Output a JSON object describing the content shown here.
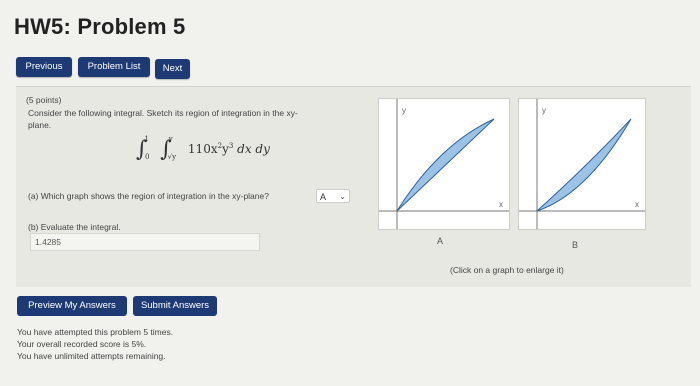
{
  "page": {
    "title": "HW5: Problem 5",
    "nav": {
      "previous": "Previous",
      "problem_list": "Problem List",
      "next": "Next"
    }
  },
  "problem": {
    "points": "(5 points)",
    "prompt_line1": "Consider the following integral. Sketch its region of integration in the xy-",
    "prompt_line2": "plane.",
    "integral": {
      "coefficient": "110x",
      "x_exp": "2",
      "y_var": "y",
      "y_exp": "3",
      "differentials": "dx dy",
      "outer_lower": "0",
      "outer_upper": "1",
      "inner_lower": "√y",
      "inner_upper": "y"
    },
    "part_a": {
      "question": "(a) Which graph shows the region of integration in the xy-plane?",
      "selected": "A"
    },
    "part_b": {
      "label": "(b) Evaluate the integral.",
      "value": "1.4285"
    }
  },
  "graphs": {
    "a_label": "A",
    "b_label": "B",
    "caption": "(Click on a graph to enlarge it)"
  },
  "actions": {
    "preview": "Preview My Answers",
    "submit": "Submit Answers"
  },
  "status": {
    "attempted": "You have attempted this problem 5 times.",
    "score": "Your overall recorded score is 5%.",
    "remaining": "You have unlimited attempts remaining."
  },
  "colors": {
    "button": "#1e3a75",
    "region_fill": "#9cc3e6",
    "region_stroke": "#2f5f9a"
  }
}
